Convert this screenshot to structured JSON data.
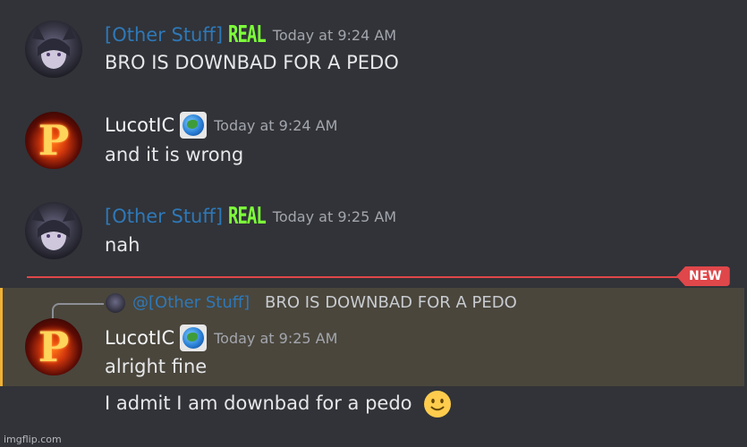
{
  "messages": [
    {
      "author": "[Other Stuff]",
      "tag": "REAL",
      "time": "Today at 9:24 AM",
      "text": "BRO IS DOWNBAD FOR A PEDO",
      "avatar": "anime-cat-avatar"
    },
    {
      "author": "LucotIC",
      "time": "Today at 9:24 AM",
      "text": "and it is wrong",
      "avatar": "flaming-p-avatar",
      "badge_icon": "globe-icon"
    },
    {
      "author": "[Other Stuff]",
      "tag": "REAL",
      "time": "Today at 9:25 AM",
      "text": "nah",
      "avatar": "anime-cat-avatar"
    },
    {
      "reply_mention": "@[Other Stuff]",
      "reply_text": "BRO IS DOWNBAD FOR A PEDO",
      "author": "LucotIC",
      "time": "Today at 9:25 AM",
      "text": "alright fine",
      "text2": "I admit I am downbad for a pedo",
      "emoji": "slightly-smiling-face",
      "avatar": "flaming-p-avatar",
      "badge_icon": "globe-icon"
    }
  ],
  "divider": {
    "label": "NEW"
  },
  "avatar_letter": "P",
  "watermark": "imgflip.com",
  "colors": {
    "background": "#313338",
    "author_blue": "#2e78b8",
    "real_tag": "#7dff3a",
    "new_divider": "#e0474a",
    "highlight_bar": "#f0b232",
    "highlight_bg": "#4a463c"
  }
}
